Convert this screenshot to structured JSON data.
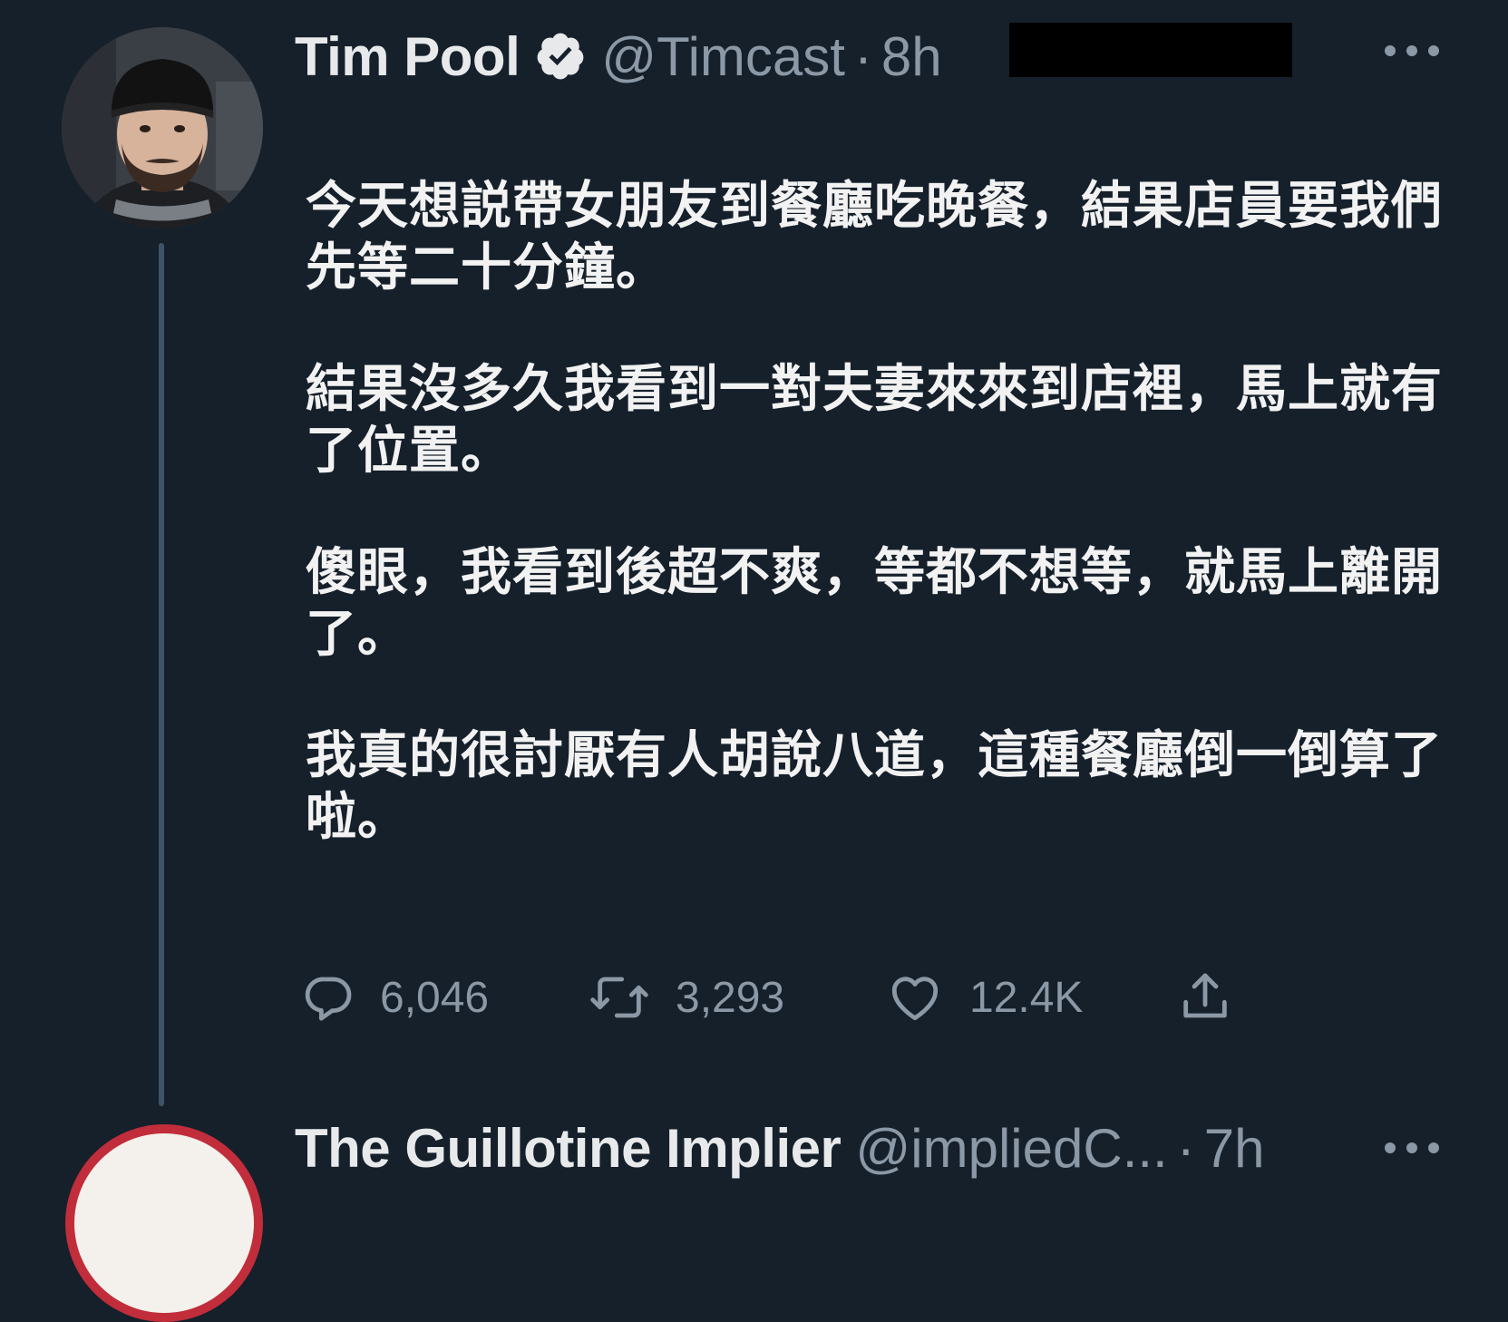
{
  "tweet": {
    "display_name": "Tim Pool",
    "verified_icon": "verified-badge-icon",
    "handle": "@Timcast",
    "separator": "·",
    "time": "8h",
    "more_icon": "more-options-icon",
    "paragraphs": [
      "今天想説帶女朋友到餐廳吃晚餐，結果店員要我們先等二十分鐘。",
      "結果沒多久我看到一對夫妻來來到店裡，馬上就有了位置。",
      "傻眼，我看到後超不爽，等都不想等，就馬上離開了。",
      "我真的很討厭有人胡說八道，這種餐廳倒一倒算了啦。"
    ],
    "actions": {
      "reply_count": "6,046",
      "retweet_count": "3,293",
      "like_count": "12.4K"
    }
  },
  "next_tweet": {
    "display_name": "The Guillotine Implier",
    "handle": "@impliedC...",
    "separator": "·",
    "time": "7h"
  },
  "colors": {
    "background": "#15202b",
    "text_primary": "#e7e9ea",
    "text_secondary": "#8b98a5",
    "thread_line": "#3d5466"
  }
}
